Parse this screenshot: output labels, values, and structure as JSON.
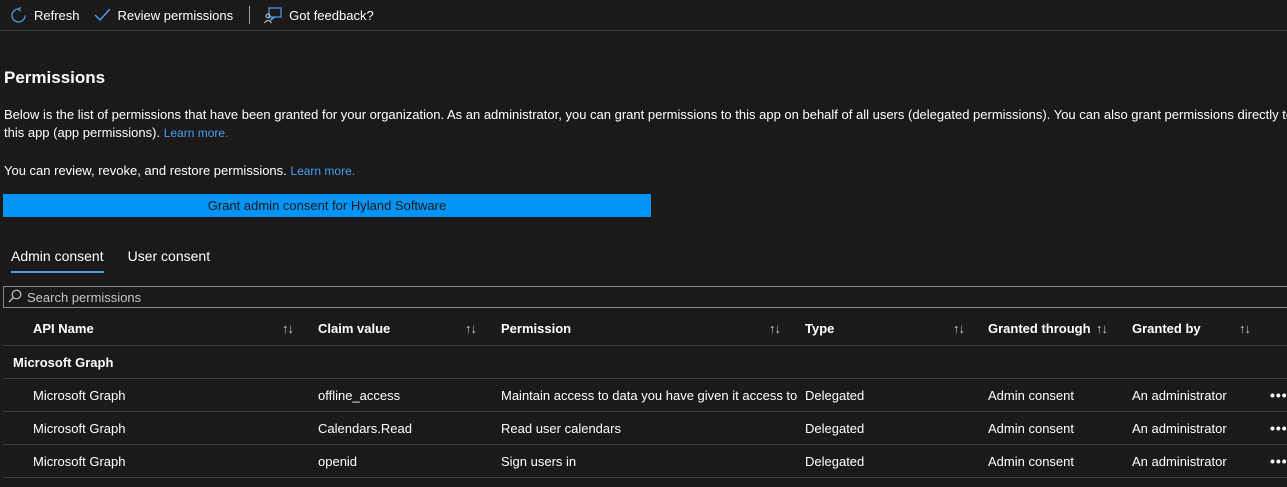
{
  "toolbar": {
    "refresh_label": "Refresh",
    "review_label": "Review permissions",
    "feedback_label": "Got feedback?"
  },
  "page": {
    "title": "Permissions",
    "description": "Below is the list of permissions that have been granted for your organization. As an administrator, you can grant permissions to this app on behalf of all users (delegated permissions). You can also grant permissions directly to this app (app permissions).",
    "description_link": "Learn more.",
    "review_text": "You can review, revoke, and restore permissions.",
    "review_link": "Learn more."
  },
  "grant_button": "Grant admin consent for Hyland Software",
  "tabs": {
    "admin": "Admin consent",
    "user": "User consent"
  },
  "search": {
    "placeholder": "Search permissions"
  },
  "table": {
    "columns": {
      "api_name": "API Name",
      "claim_value": "Claim value",
      "permission": "Permission",
      "type": "Type",
      "granted_through": "Granted through",
      "granted_by": "Granted by"
    },
    "sort_glyph": "↑↓",
    "more_glyph": "•••",
    "group_label": "Microsoft Graph",
    "rows": [
      {
        "api_name": "Microsoft Graph",
        "claim_value": "offline_access",
        "permission": "Maintain access to data you have given it access to",
        "type": "Delegated",
        "granted_through": "Admin consent",
        "granted_by": "An administrator"
      },
      {
        "api_name": "Microsoft Graph",
        "claim_value": "Calendars.Read",
        "permission": "Read user calendars",
        "type": "Delegated",
        "granted_through": "Admin consent",
        "granted_by": "An administrator"
      },
      {
        "api_name": "Microsoft Graph",
        "claim_value": "openid",
        "permission": "Sign users in",
        "type": "Delegated",
        "granted_through": "Admin consent",
        "granted_by": "An administrator"
      }
    ]
  },
  "colors": {
    "background": "#1b1a19",
    "accent": "#0094f6",
    "link": "#479ef5",
    "divider": "#3b3a39"
  }
}
